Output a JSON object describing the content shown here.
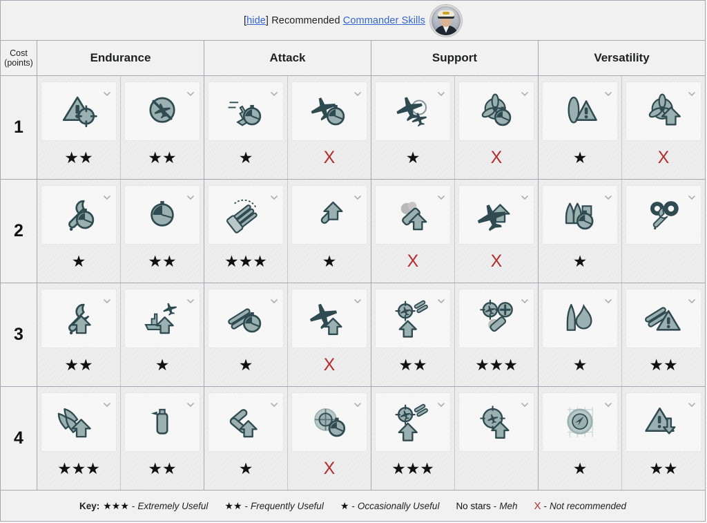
{
  "header": {
    "hide_label": "hide",
    "bracket_open": "[",
    "bracket_close": "]",
    "recommended_label": "Recommended",
    "link_label": "Commander Skills",
    "avatar_name": "commander-portrait"
  },
  "table": {
    "cost_header_line1": "Cost",
    "cost_header_line2": "(points)",
    "categories": [
      "Endurance",
      "Attack",
      "Support",
      "Versatility"
    ],
    "rows": [
      {
        "cost": "1",
        "cells": [
          {
            "category": "Endurance",
            "icon": "warning-triangle-reticle-icon",
            "rating": "★★",
            "rating_type": "stars"
          },
          {
            "category": "Endurance",
            "icon": "no-plane-circle-icon",
            "rating": "★★",
            "rating_type": "stars"
          },
          {
            "category": "Attack",
            "icon": "ship-speed-stopwatch-icon",
            "rating": "★",
            "rating_type": "stars"
          },
          {
            "category": "Attack",
            "icon": "plane-stopwatch-icon",
            "rating": "X",
            "rating_type": "not-recommended"
          },
          {
            "category": "Support",
            "icon": "two-planes-reticle-icon",
            "rating": "★",
            "rating_type": "stars"
          },
          {
            "category": "Support",
            "icon": "propeller-stopwatch-icon",
            "rating": "X",
            "rating_type": "not-recommended"
          },
          {
            "category": "Versatility",
            "icon": "torpedo-warning-icon",
            "rating": "★",
            "rating_type": "stars"
          },
          {
            "category": "Versatility",
            "icon": "propeller-up-arrow-icon",
            "rating": "X",
            "rating_type": "not-recommended"
          }
        ]
      },
      {
        "cost": "2",
        "cells": [
          {
            "category": "Endurance",
            "icon": "wrench-stopwatch-icon",
            "rating": "★",
            "rating_type": "stars"
          },
          {
            "category": "Endurance",
            "icon": "stopwatch-icon",
            "rating": "★★",
            "rating_type": "stars"
          },
          {
            "category": "Attack",
            "icon": "turret-traverse-icon",
            "rating": "★★★",
            "rating_type": "stars"
          },
          {
            "category": "Attack",
            "icon": "torpedo-up-arrow-icon",
            "rating": "★",
            "rating_type": "stars"
          },
          {
            "category": "Support",
            "icon": "smoke-generator-up-arrow-icon",
            "rating": "X",
            "rating_type": "not-recommended"
          },
          {
            "category": "Support",
            "icon": "plane-up-arrow-icon",
            "rating": "X",
            "rating_type": "not-recommended"
          },
          {
            "category": "Versatility",
            "icon": "magazine-stopwatch-icon",
            "rating": "★",
            "rating_type": "stars"
          },
          {
            "category": "Versatility",
            "icon": "gears-wrench-icon",
            "rating": "",
            "rating_type": "none"
          }
        ]
      },
      {
        "cost": "3",
        "cells": [
          {
            "category": "Endurance",
            "icon": "wrench-up-arrow-icon",
            "rating": "★★",
            "rating_type": "stars"
          },
          {
            "category": "Endurance",
            "icon": "ship-plane-up-arrow-icon",
            "rating": "★",
            "rating_type": "stars"
          },
          {
            "category": "Attack",
            "icon": "guns-stopwatch-icon",
            "rating": "★",
            "rating_type": "stars"
          },
          {
            "category": "Attack",
            "icon": "plane-up-arrow-icon-2",
            "rating": "X",
            "rating_type": "not-recommended"
          },
          {
            "category": "Support",
            "icon": "aa-planes-up-arrow-icon",
            "rating": "★★",
            "rating_type": "stars"
          },
          {
            "category": "Support",
            "icon": "aa-plus-smoke-icon",
            "rating": "★★★",
            "rating_type": "stars"
          },
          {
            "category": "Versatility",
            "icon": "shell-fire-icon",
            "rating": "★",
            "rating_type": "stars"
          },
          {
            "category": "Versatility",
            "icon": "guns-warning-icon",
            "rating": "★★",
            "rating_type": "stars"
          }
        ]
      },
      {
        "cost": "4",
        "cells": [
          {
            "category": "Endurance",
            "icon": "shells-up-arrow-icon",
            "rating": "★★★",
            "rating_type": "stars"
          },
          {
            "category": "Endurance",
            "icon": "smoke-canister-icon",
            "rating": "★★",
            "rating_type": "stars"
          },
          {
            "category": "Attack",
            "icon": "torpedoes-up-arrow-icon",
            "rating": "★",
            "rating_type": "stars"
          },
          {
            "category": "Attack",
            "icon": "radar-reticle-stopwatch-icon",
            "rating": "X",
            "rating_type": "not-recommended"
          },
          {
            "category": "Support",
            "icon": "aa-shells-up-arrow-icon",
            "rating": "★★★",
            "rating_type": "stars"
          },
          {
            "category": "Support",
            "icon": "plane-reticle-up-arrow-icon",
            "rating": "",
            "rating_type": "none"
          },
          {
            "category": "Versatility",
            "icon": "radar-compass-icon",
            "rating": "★",
            "rating_type": "stars"
          },
          {
            "category": "Versatility",
            "icon": "warning-down-arrow-icon",
            "rating": "★★",
            "rating_type": "stars"
          }
        ]
      }
    ]
  },
  "key": {
    "label": "Key:",
    "items": [
      {
        "symbol": "★★★",
        "dash": "-",
        "description": "Extremely Useful",
        "type": "stars"
      },
      {
        "symbol": "★★",
        "dash": "-",
        "description": "Frequently Useful",
        "type": "stars"
      },
      {
        "symbol": "★",
        "dash": "-",
        "description": "Occasionally Useful",
        "type": "stars"
      },
      {
        "symbol": "No stars",
        "dash": "-",
        "description": "Meh",
        "type": "word"
      },
      {
        "symbol": "X",
        "dash": "-",
        "description": "Not recommended",
        "type": "red"
      }
    ]
  },
  "colors": {
    "link": "#3366cc",
    "not_recommended": "#b32d2e",
    "icon_dark": "#2f4a50",
    "icon_fill": "#92a8a8",
    "border": "#a2a9b1",
    "cell_bg": "#eeeeee",
    "tile_bg": "#f7f7f7"
  }
}
